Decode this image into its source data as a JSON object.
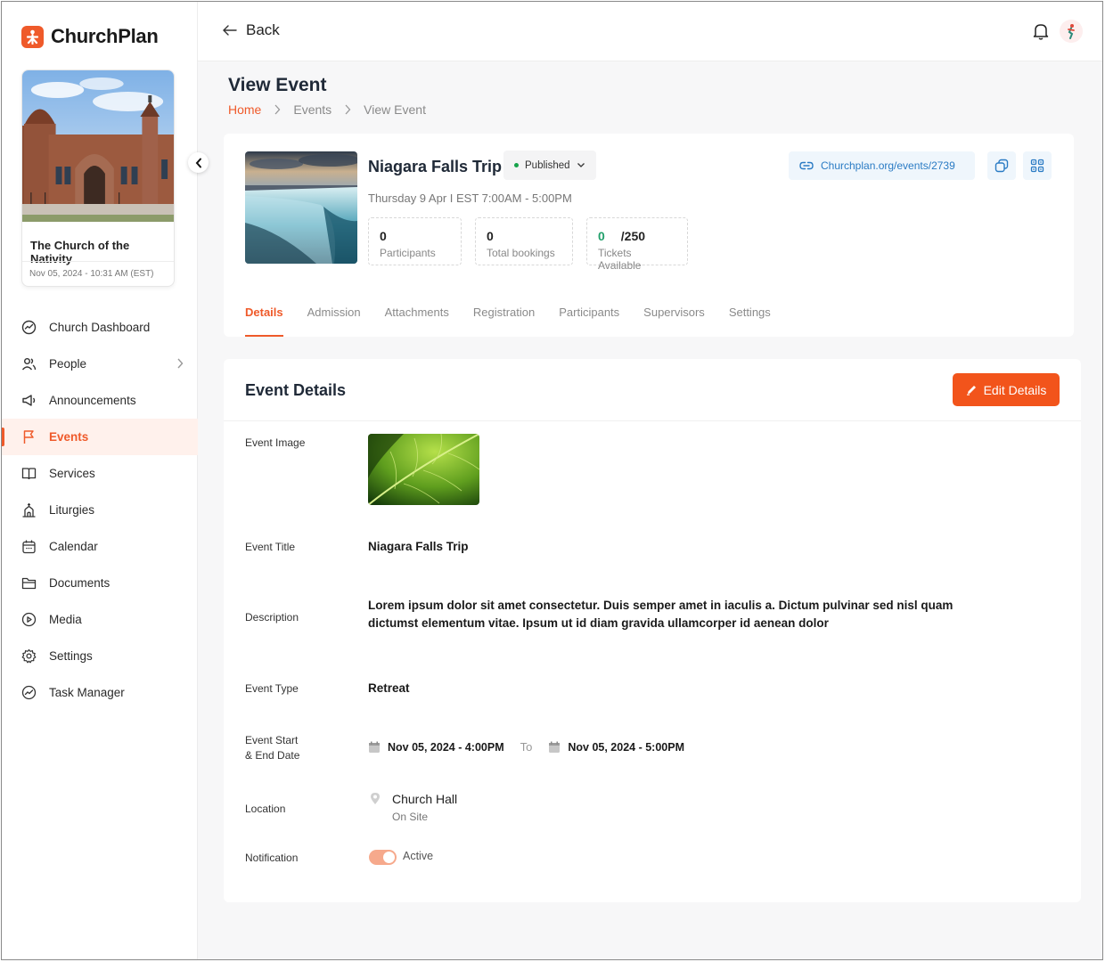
{
  "app": {
    "name": "ChurchPlan"
  },
  "church": {
    "name": "The Church of the Nativity",
    "date": "Nov 05, 2024 - 10:31 AM (EST)"
  },
  "sidebar": {
    "items": [
      {
        "label": "Church Dashboard",
        "icon": "dashboard-icon"
      },
      {
        "label": "People",
        "icon": "people-icon"
      },
      {
        "label": "Announcements",
        "icon": "megaphone-icon"
      },
      {
        "label": "Events",
        "icon": "flag-icon",
        "active": true
      },
      {
        "label": "Services",
        "icon": "book-icon"
      },
      {
        "label": "Liturgies",
        "icon": "church-icon"
      },
      {
        "label": "Calendar",
        "icon": "calendar-icon"
      },
      {
        "label": "Documents",
        "icon": "folder-icon"
      },
      {
        "label": "Media",
        "icon": "play-icon"
      },
      {
        "label": "Settings",
        "icon": "gear-icon"
      },
      {
        "label": "Task Manager",
        "icon": "tasks-icon"
      }
    ]
  },
  "topbar": {
    "back_label": "Back"
  },
  "page": {
    "title": "View Event",
    "breadcrumb": [
      "Home",
      "Events",
      "View Event"
    ]
  },
  "event": {
    "name": "Niagara Falls Trip",
    "status": "Published",
    "when": "Thursday 9 Apr I EST 7:00AM - 5:00PM",
    "stats": {
      "participants": {
        "value": "0",
        "label": "Participants"
      },
      "bookings": {
        "value": "0",
        "label": "Total bookings"
      },
      "tickets": {
        "available": "0",
        "total": "/250",
        "label": "Tickets Available"
      }
    },
    "link": "Churchplan.org/events/2739",
    "tabs": [
      "Details",
      "Admission",
      "Attachments",
      "Registration",
      "Participants",
      "Supervisors",
      "Settings"
    ],
    "active_tab": "Details"
  },
  "details": {
    "heading": "Event Details",
    "edit_label": "Edit Details",
    "labels": {
      "image": "Event Image",
      "title": "Event Title",
      "description": "Description",
      "type": "Event Type",
      "dates_line1": "Event Start",
      "dates_line2": "& End Date",
      "location": "Location",
      "notification": "Notification"
    },
    "title": "Niagara Falls Trip",
    "description": "Lorem ipsum dolor sit amet consectetur. Duis semper amet in iaculis a. Dictum pulvinar sed nisl quam dictumst elementum vitae. Ipsum ut id diam gravida ullamcorper id aenean dolor",
    "type": "Retreat",
    "start": "Nov 05, 2024 - 4:00PM",
    "to_label": "To",
    "end": "Nov 05, 2024 - 5:00PM",
    "location_name": "Church Hall",
    "location_sub": "On Site",
    "notification": {
      "on": true,
      "label": "Active"
    }
  },
  "colors": {
    "accent": "#ef5a2a",
    "link": "#2a7bc4",
    "success": "#16a34a"
  }
}
